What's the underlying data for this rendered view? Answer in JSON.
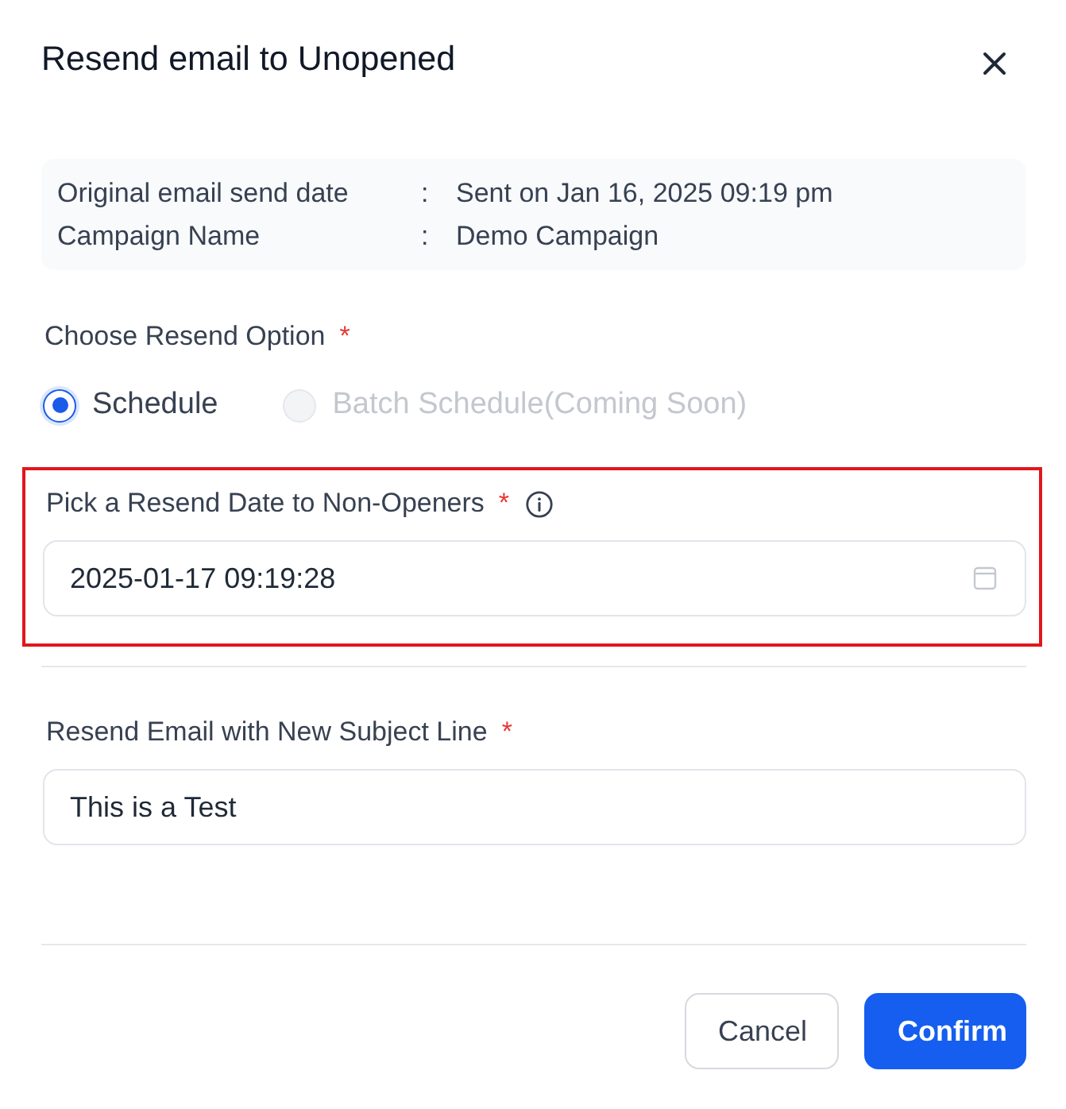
{
  "dialog": {
    "title": "Resend email to Unopened"
  },
  "summary": [
    {
      "label": "Original email send date",
      "separator": ":",
      "value": "Sent on Jan 16, 2025 09:19 pm"
    },
    {
      "label": "Campaign Name",
      "separator": ":",
      "value": "Demo Campaign"
    }
  ],
  "resend_option": {
    "label": "Choose Resend Option",
    "required_mark": "*",
    "options": [
      {
        "label": "Schedule",
        "selected": true,
        "disabled": false
      },
      {
        "label": "Batch Schedule(Coming Soon)",
        "selected": false,
        "disabled": true
      }
    ]
  },
  "fields": [
    {
      "kind": "date",
      "label": "Pick a Resend Date to Non-Openers",
      "required_mark": "*",
      "info_icon": true,
      "highlighted": true,
      "value": "2025-01-17 09:19:28"
    },
    {
      "kind": "text",
      "label": "Resend Email with New Subject Line",
      "required_mark": "*",
      "info_icon": false,
      "highlighted": false,
      "value": "This is a Test"
    }
  ],
  "buttons": [
    {
      "label": "Cancel",
      "kind": "secondary"
    },
    {
      "label": "Confirm",
      "kind": "primary"
    }
  ]
}
